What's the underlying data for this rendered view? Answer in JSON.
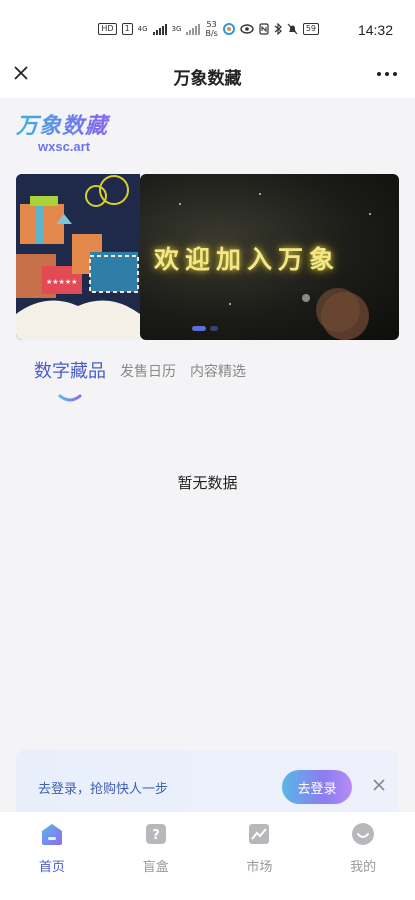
{
  "status_bar": {
    "hd_badge": "HD",
    "sim_badge": "1",
    "signal1_label": "4G",
    "signal2_label": "3G",
    "speed_value": "53",
    "speed_unit": "B/s",
    "battery": "59",
    "time": "14:32"
  },
  "header": {
    "title": "万象数藏",
    "close_icon": "close-icon",
    "more_icon": "more-icon"
  },
  "logo": {
    "name": "万象数藏",
    "domain": "wxsc.art"
  },
  "banner": {
    "text": "欢迎加入万象",
    "slides_count": 2,
    "active_slide": 1
  },
  "tabs": [
    {
      "label": "数字藏品",
      "active": true
    },
    {
      "label": "发售日历",
      "active": false
    },
    {
      "label": "内容精选",
      "active": false
    }
  ],
  "empty_state": {
    "text": "暂无数据"
  },
  "login_prompt": {
    "message": "去登录，抢购快人一步",
    "button_label": "去登录"
  },
  "bottom_nav": [
    {
      "label": "首页",
      "icon": "home-icon",
      "active": true
    },
    {
      "label": "盲盒",
      "icon": "blind-box-icon",
      "active": false
    },
    {
      "label": "市场",
      "icon": "market-icon",
      "active": false
    },
    {
      "label": "我的",
      "icon": "profile-icon",
      "active": false
    }
  ],
  "colors": {
    "accent": "#4a5ec8",
    "inactive": "#999999",
    "background": "#f4f4f6"
  }
}
